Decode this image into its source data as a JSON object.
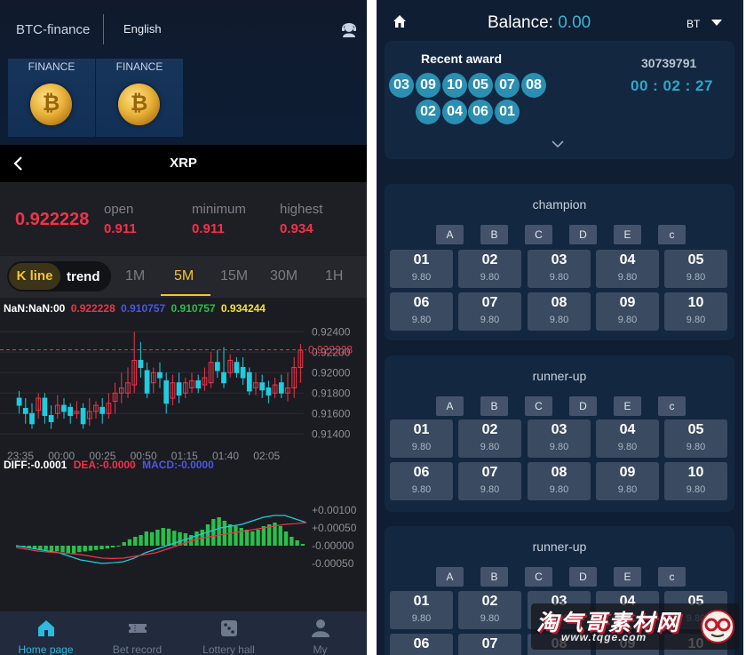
{
  "left": {
    "header": {
      "brand": "BTC-finance",
      "language": "English",
      "user_icon": "user-headset-icon",
      "cards": [
        {
          "label": "FINANCE",
          "icon": "bitcoin-coin-icon"
        },
        {
          "label": "FINANCE",
          "icon": "bitcoin-coin-icon"
        }
      ]
    },
    "nav": {
      "back_icon": "chevron-left-icon",
      "title": "XRP"
    },
    "price": {
      "current": "0.922228",
      "open_label": "open",
      "open_value": "0.911",
      "min_label": "minimum",
      "min_value": "0.911",
      "max_label": "highest",
      "max_value": "0.934"
    },
    "tabs": {
      "kline": "K line",
      "trend": "trend",
      "intervals": [
        "1M",
        "5M",
        "15M",
        "30M",
        "1H"
      ],
      "active_interval": "5M"
    },
    "chart_legend": {
      "label": "NaN:NaN:00",
      "v1": "0.922228",
      "v2": "0.910757",
      "v3": "0.910757",
      "v4": "0.934244"
    },
    "macd_legend": {
      "diff": "DIFF:-0.0001",
      "dea": "DEA:-0.0000",
      "macd": "MACD:-0.0000"
    },
    "bottom_nav": [
      {
        "label": "Home page",
        "icon": "home-icon",
        "active": true
      },
      {
        "label": "Bet record",
        "icon": "ticket-icon",
        "active": false
      },
      {
        "label": "Lottery hall",
        "icon": "dice-icon",
        "active": false
      },
      {
        "label": "My",
        "icon": "person-icon",
        "active": false
      }
    ],
    "colors": {
      "up": "#f0334a",
      "down": "#1ecde0",
      "accent": "#f5c52c",
      "green": "#28c04b"
    }
  },
  "chart_data": [
    {
      "type": "candlestick",
      "title": "",
      "x_tick_labels": [
        "23:35",
        "00:00",
        "00:25",
        "00:50",
        "01:15",
        "01:40",
        "02:05"
      ],
      "y_tick_labels": [
        "0.92400",
        "0.92200",
        "0.92000",
        "0.91800",
        "0.91600",
        "0.91400"
      ],
      "ylim": [
        0.9135,
        0.9255
      ],
      "current_price_line": "0.922228",
      "candles": [
        [
          0.9175,
          0.9168,
          0.9182,
          0.916
        ],
        [
          0.9165,
          0.916,
          0.9175,
          0.915
        ],
        [
          0.916,
          0.915,
          0.917,
          0.9145
        ],
        [
          0.9163,
          0.9175,
          0.918,
          0.9155
        ],
        [
          0.9175,
          0.9158,
          0.918,
          0.915
        ],
        [
          0.9158,
          0.9152,
          0.9168,
          0.9145
        ],
        [
          0.916,
          0.9168,
          0.9178,
          0.9155
        ],
        [
          0.9168,
          0.9162,
          0.9175,
          0.9155
        ],
        [
          0.9166,
          0.9158,
          0.917,
          0.915
        ],
        [
          0.916,
          0.9162,
          0.9172,
          0.9155
        ],
        [
          0.9165,
          0.915,
          0.917,
          0.9145
        ],
        [
          0.9155,
          0.9162,
          0.9175,
          0.9148
        ],
        [
          0.9162,
          0.9168,
          0.9172,
          0.9155
        ],
        [
          0.9166,
          0.916,
          0.9175,
          0.915
        ],
        [
          0.916,
          0.917,
          0.918,
          0.9155
        ],
        [
          0.9172,
          0.918,
          0.919,
          0.916
        ],
        [
          0.918,
          0.9185,
          0.92,
          0.917
        ],
        [
          0.918,
          0.919,
          0.9205,
          0.9175
        ],
        [
          0.9188,
          0.9212,
          0.924,
          0.918
        ],
        [
          0.9212,
          0.9205,
          0.923,
          0.9195
        ],
        [
          0.9202,
          0.918,
          0.921,
          0.9175
        ],
        [
          0.919,
          0.92,
          0.9205,
          0.918
        ],
        [
          0.92,
          0.9195,
          0.921,
          0.9185
        ],
        [
          0.9192,
          0.917,
          0.92,
          0.916
        ],
        [
          0.9175,
          0.919,
          0.9198,
          0.9168
        ],
        [
          0.919,
          0.9178,
          0.92,
          0.917
        ],
        [
          0.918,
          0.919,
          0.9195,
          0.9175
        ],
        [
          0.9185,
          0.9192,
          0.92,
          0.918
        ],
        [
          0.9192,
          0.9185,
          0.9198,
          0.918
        ],
        [
          0.9188,
          0.9195,
          0.9205,
          0.9182
        ],
        [
          0.919,
          0.921,
          0.922,
          0.9185
        ],
        [
          0.921,
          0.9202,
          0.9222,
          0.9195
        ],
        [
          0.92,
          0.919,
          0.9225,
          0.9185
        ],
        [
          0.92,
          0.9212,
          0.9218,
          0.9195
        ],
        [
          0.921,
          0.92,
          0.9215,
          0.9195
        ],
        [
          0.9205,
          0.9195,
          0.9215,
          0.9188
        ],
        [
          0.92,
          0.9182,
          0.9205,
          0.9178
        ],
        [
          0.9185,
          0.919,
          0.92,
          0.9178
        ],
        [
          0.919,
          0.9183,
          0.9198,
          0.9175
        ],
        [
          0.9185,
          0.9178,
          0.9192,
          0.917
        ],
        [
          0.918,
          0.9188,
          0.9195,
          0.9175
        ],
        [
          0.919,
          0.918,
          0.9198,
          0.9175
        ],
        [
          0.918,
          0.9185,
          0.92,
          0.9172
        ],
        [
          0.9185,
          0.9205,
          0.9215,
          0.9175
        ],
        [
          0.9205,
          0.9222,
          0.9228,
          0.919
        ]
      ]
    },
    {
      "type": "bar",
      "title": "",
      "y_tick_labels": [
        "+0.00100",
        "+0.00050",
        "-0.00000",
        "-0.00050"
      ],
      "ylim": [
        -0.0008,
        0.0012
      ],
      "histogram": [
        -3e-05,
        -2e-05,
        -5e-05,
        -8e-05,
        -0.0001,
        -0.00012,
        -0.00015,
        -0.00016,
        -0.00018,
        -0.0002,
        -0.00022,
        -0.00018,
        -0.00016,
        -0.00014,
        -0.00012,
        -0.0001,
        -8e-05,
        -5e-05,
        -2e-05,
        0.0001,
        0.00018,
        0.00025,
        0.0003,
        0.0004,
        0.00038,
        0.00045,
        0.0005,
        0.00048,
        0.00042,
        0.00038,
        0.00035,
        0.0003,
        0.0004,
        0.00045,
        0.0006,
        0.00075,
        0.0008,
        0.0007,
        0.0006,
        0.00055,
        0.0005,
        0.00045,
        0.0004,
        0.00045,
        0.00055,
        0.0006,
        0.00065,
        0.00055,
        0.0004,
        0.00025,
        0.00015,
        5e-05
      ],
      "series": [
        {
          "values": [
            0.0,
            -5e-05,
            -0.0001,
            -0.00015,
            -0.0002,
            -0.0003,
            -0.0004,
            -0.00045,
            -0.0005,
            -0.00048,
            -0.00045,
            -0.00035,
            -0.0002,
            -0.0001,
            0.0,
            0.0001,
            0.0002,
            0.0003,
            0.0004,
            0.0005,
            0.00055,
            0.0006,
            0.0007,
            0.0008,
            0.00085,
            0.00085,
            0.00075,
            0.00065
          ]
        },
        {
          "values": [
            -5e-05,
            -0.0001,
            -0.00015,
            -0.00018,
            -0.0002,
            -0.00022,
            -0.00025,
            -0.0003,
            -0.00035,
            -0.00036,
            -0.00035,
            -0.0003,
            -0.00025,
            -0.0002,
            -0.0001,
            0.0,
            0.0001,
            0.0002,
            0.00025,
            0.0003,
            0.00035,
            0.0004,
            0.00045,
            0.0005,
            0.00055,
            0.0006,
            0.00062,
            0.00065
          ]
        }
      ]
    }
  ],
  "right": {
    "home_icon": "home-icon",
    "balance_label": "Balance:",
    "balance_value": "0.00",
    "currency": "BT",
    "award": {
      "title": "Recent award",
      "issue": "30739791",
      "timer": "00 : 02 : 27",
      "row1": [
        "03",
        "09",
        "10",
        "05",
        "07",
        "08"
      ],
      "row2": [
        "02",
        "04",
        "06",
        "01"
      ],
      "expand_icon": "chevron-down-icon"
    },
    "sections": [
      {
        "title": "champion"
      },
      {
        "title": "runner-up"
      },
      {
        "title": "runner-up"
      }
    ],
    "tags": [
      "A",
      "B",
      "C",
      "D",
      "E",
      "c"
    ],
    "cells": [
      {
        "num": "01",
        "odds": "9.80"
      },
      {
        "num": "02",
        "odds": "9.80"
      },
      {
        "num": "03",
        "odds": "9.80"
      },
      {
        "num": "04",
        "odds": "9.80"
      },
      {
        "num": "05",
        "odds": "9.80"
      },
      {
        "num": "06",
        "odds": "9.80"
      },
      {
        "num": "07",
        "odds": "9.80"
      },
      {
        "num": "08",
        "odds": "9.80"
      },
      {
        "num": "09",
        "odds": "9.80"
      },
      {
        "num": "10",
        "odds": "9.80"
      }
    ],
    "watermark": {
      "brand": "淘气哥素材网",
      "url": "www.tqge.com",
      "icon": "glasses-face-icon"
    }
  }
}
